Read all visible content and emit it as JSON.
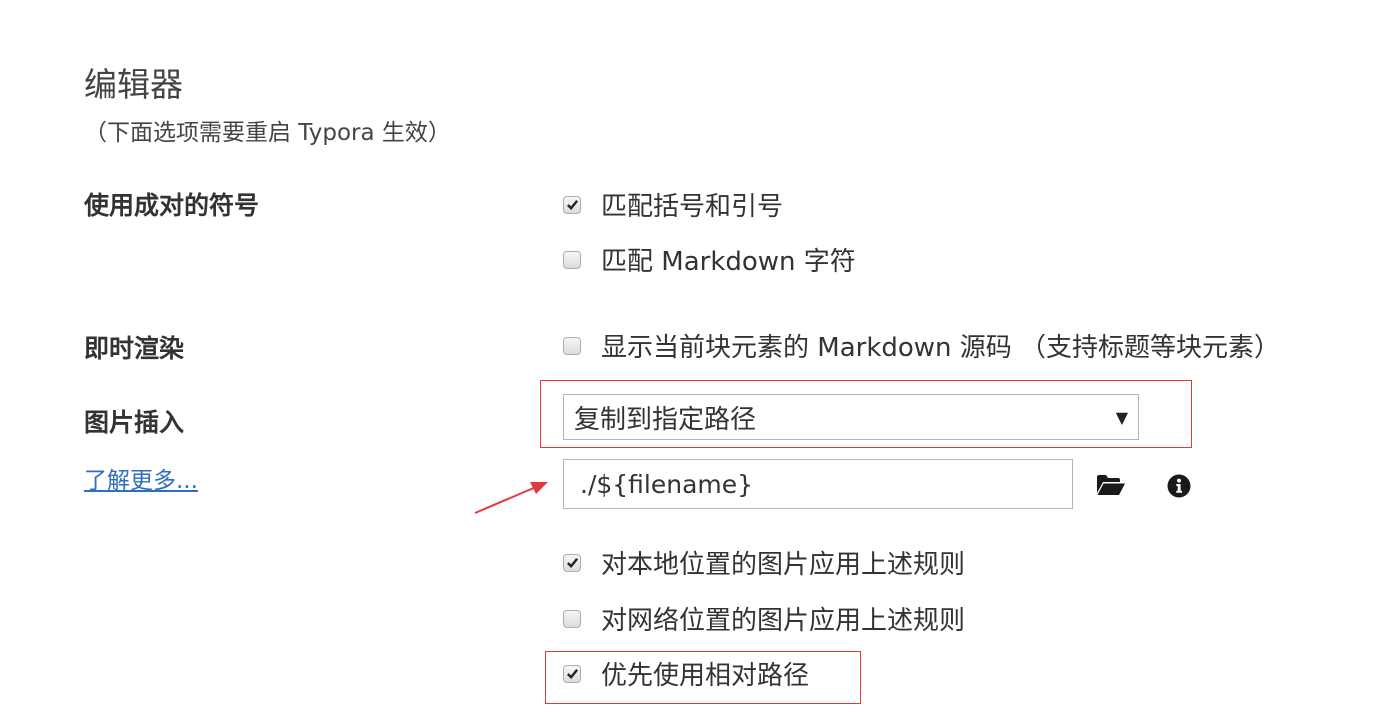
{
  "section": {
    "title": "编辑器",
    "note": "（下面选项需要重启 Typora 生效）"
  },
  "pair_symbols": {
    "label": "使用成对的符号",
    "options": [
      {
        "label": "匹配括号和引号",
        "checked": true
      },
      {
        "label": "匹配 Markdown 字符",
        "checked": false
      }
    ]
  },
  "live_render": {
    "label": "即时渲染",
    "options": [
      {
        "label": "显示当前块元素的 Markdown 源码 （支持标题等块元素）",
        "checked": false
      }
    ]
  },
  "image_insert": {
    "label": "图片插入",
    "learn_more": "了解更多...",
    "select_value": "复制到指定路径",
    "path_value": "./${filename}",
    "options": [
      {
        "label": "对本地位置的图片应用上述规则",
        "checked": true
      },
      {
        "label": "对网络位置的图片应用上述规则",
        "checked": false
      },
      {
        "label": "优先使用相对路径",
        "checked": true
      }
    ]
  },
  "icons": {
    "folder": "folder-open-icon",
    "info": "info-circle-icon",
    "dropdown": "triangle-down-icon",
    "check": "check-icon"
  },
  "colors": {
    "annotation": "#e23b3b",
    "link": "#2f6fbf"
  }
}
